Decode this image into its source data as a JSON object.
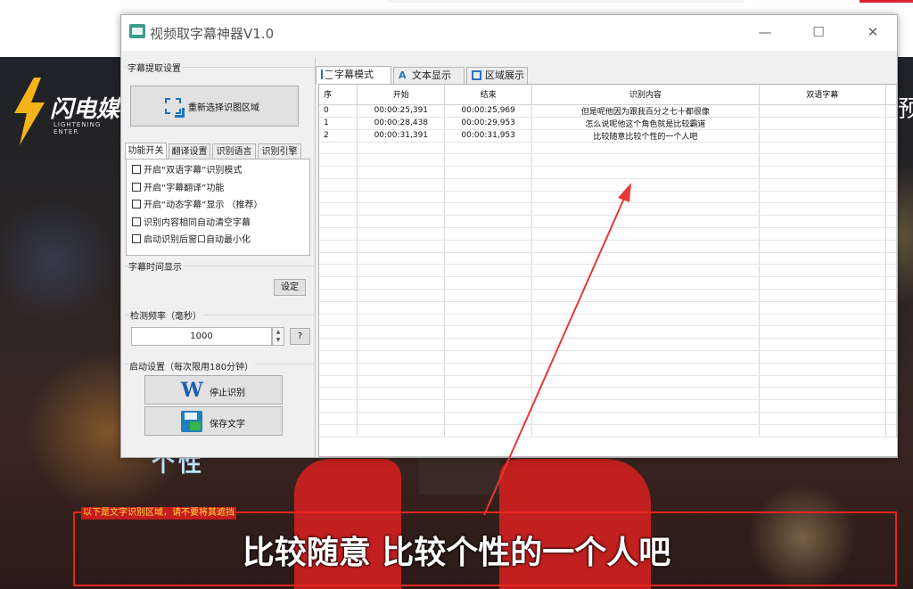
{
  "window": {
    "title": "视频取字幕神器V1.0",
    "minimize": "—",
    "maximize": "☐",
    "close": "✕"
  },
  "left": {
    "extract_section": "字幕提取设置",
    "reselect_button": "重新选择识图区域",
    "tabs": [
      "功能开关",
      "翻译设置",
      "识别语言",
      "识别引擎"
    ],
    "options": [
      "开启“双语字幕”识别模式",
      "开启“字幕翻译”功能",
      "开启“动态字幕”显示    （推荐）",
      "识别内容相同自动清空字幕",
      "启动识别后窗口自动最小化"
    ],
    "time_section": "字幕时间显示",
    "set_button": "设定",
    "freq_section": "检测频率（毫秒）",
    "freq_value": "1000",
    "help_button": "?",
    "start_section": "启动设置（每次限用180分钟）",
    "stop_button": "停止识别",
    "save_button": "保存文字"
  },
  "right": {
    "tabs": [
      "字幕模式",
      "文本显示",
      "区域展示"
    ],
    "columns": [
      "序",
      "开始",
      "结束",
      "识别内容",
      "双语字幕"
    ],
    "rows": [
      [
        "0",
        "00:00:25,391",
        "00:00:25,969",
        "但是呢他因为跟我百分之七十都很像",
        ""
      ],
      [
        "1",
        "00:00:28,438",
        "00:00:29,953",
        "怎么说呢他这个角色就是比较霸道",
        ""
      ],
      [
        "2",
        "00:00:31,391",
        "00:00:31,953",
        "比较随意比较个性的一个人吧",
        ""
      ]
    ]
  },
  "background": {
    "logo_text": "闪电媒",
    "logo_sub": "LIGHTENING ENTER",
    "region_note": "以下是文字识别区域，请不要将其遮挡",
    "subtitle": "比较随意 比较个性的一个人吧",
    "right_glyph": "预",
    "glow_text": "个性"
  },
  "colors": {
    "region_border": "#e8241f",
    "arrow": "#e53935",
    "accent": "#1a73c8"
  }
}
